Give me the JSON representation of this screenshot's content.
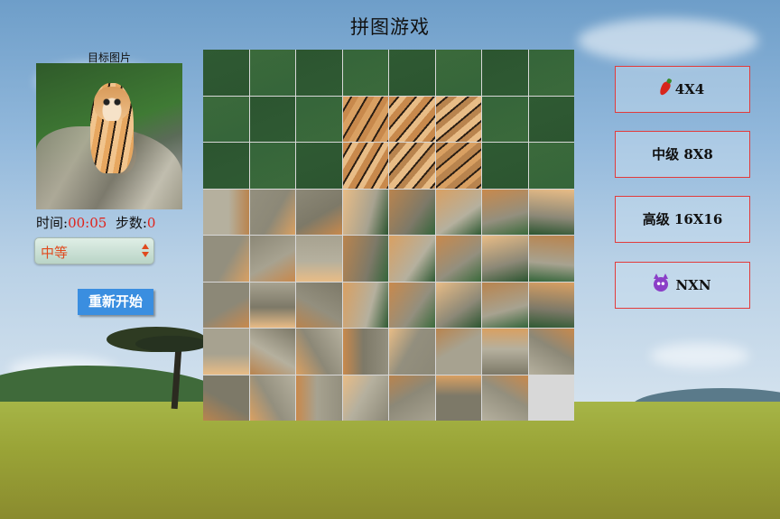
{
  "title": "拼图游戏",
  "target_label": "目标图片",
  "stats": {
    "time_label": "时间:",
    "time_value": "00:05",
    "steps_label": "步数:",
    "steps_value": "0"
  },
  "difficulty": {
    "selected": "中等"
  },
  "restart_label": "重新开始",
  "levels": [
    {
      "label": "4X4",
      "icon": "chili-icon"
    },
    {
      "label": "中级 8X8",
      "icon": ""
    },
    {
      "label": "高级 16X16",
      "icon": ""
    },
    {
      "label": "NXN",
      "icon": "devil-icon"
    }
  ],
  "board": {
    "rows": 8,
    "cols": 8,
    "empty_index": 63
  },
  "colors": {
    "time_red": "#e0221a",
    "restart_blue": "#3a8ee0",
    "level_border": "#e23b3b",
    "select_text": "#e04a1e"
  }
}
